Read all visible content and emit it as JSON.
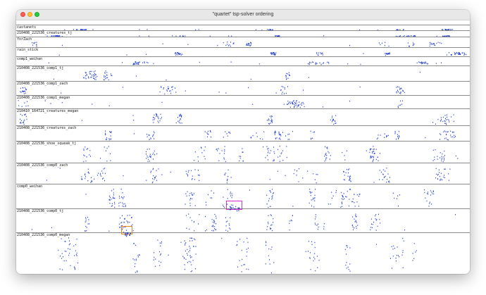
{
  "window": {
    "title": "\"quartet\" tsp-solver ordering"
  },
  "colors": {
    "onset": "#1f3bd6",
    "lane_line": "#8a8a8a",
    "highlight_magenta": "#e02ad7",
    "highlight_orange": "#f0861b"
  },
  "tracks": [
    {
      "label": "castanets"
    },
    {
      "label": "210408_221536_creatures_tj"
    },
    {
      "label": "forZach"
    },
    {
      "label": "rain_stick"
    },
    {
      "label": "comp1_weihan"
    },
    {
      "label": "210408_221536_comp1_tj"
    },
    {
      "label": "210408_221536_comp1_zach"
    },
    {
      "label": "210408_221536_comp1_megan"
    },
    {
      "label": "210410_164721_creatures_megan"
    },
    {
      "label": "210408_221536_creatures_zach"
    },
    {
      "label": "210408_221536_shoe_squeak_tj"
    },
    {
      "label": "210408_221536_comp0_zach"
    },
    {
      "label": "comp0_weihan"
    },
    {
      "label": "210408_221536_comp0_tj"
    },
    {
      "label": "210408_221536_comp0_megan"
    }
  ]
}
